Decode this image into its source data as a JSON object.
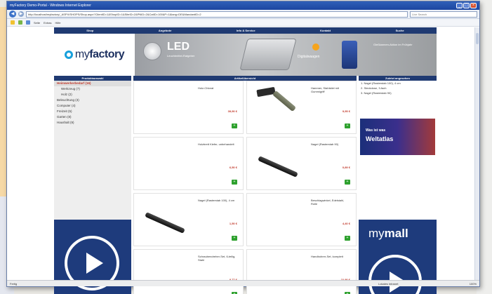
{
  "browser": {
    "title": "myFactory Demo-Portal - Windows Internet Explorer",
    "url": "http://localhost/myfactory/_ASPX/SHOPS/Shop.aspx?ClientID=1&ShopID=1&SiteID=2&PNID=2&CatID=100&P=1&lang=DE&MandantID=2",
    "search_placeholder": "Live Search",
    "toolbar_items": [
      "Seite",
      "Extras",
      "Hilfe"
    ],
    "status_text": "Fertig",
    "zone_text": "Lokales Intranet",
    "zoom_text": "100%"
  },
  "page": {
    "nav": [
      "Shop",
      "Angebote",
      "Info & Service",
      "Kontakt",
      "Suche"
    ],
    "logo": {
      "prefix": "my",
      "suffix": "factory"
    },
    "banner": {
      "led_title": "LED",
      "led_sub": "Leuchtmittel-Ratgeber",
      "scale_text": "Digitalwaagen",
      "right_text": "Gießkannen-Aktion\nim Frühjahr"
    },
    "column_headers": [
      "Produktauswahl",
      "Artikelübersicht",
      "Zuletzt angesehen"
    ],
    "categories": [
      {
        "label": "Heimwerkerbedarf (16)",
        "active": true,
        "sub": false
      },
      {
        "label": "Werkzeug (7)",
        "active": false,
        "sub": true
      },
      {
        "label": "Holz (2)",
        "active": false,
        "sub": true
      },
      {
        "label": "Beleuchtung (3)",
        "active": false,
        "sub": false
      },
      {
        "label": "Computer (4)",
        "active": false,
        "sub": false
      },
      {
        "label": "Freizeit (5)",
        "active": false,
        "sub": false
      },
      {
        "label": "Garten (8)",
        "active": false,
        "sub": false
      },
      {
        "label": "Haushalt (9)",
        "active": false,
        "sub": false
      }
    ],
    "products": [
      {
        "name": "Holz-Chlorat",
        "price": "39,90 €",
        "image": "none"
      },
      {
        "name": "Hammer, Stahlstiel mit Gummigriff",
        "price": "9,95 €",
        "image": "hammer"
      },
      {
        "name": "Holzbrett Kiefer, unbehandelt",
        "price": "6,50 €",
        "image": "none"
      },
      {
        "name": "Nagel (Rasterstab 90)",
        "price": "0,89 €",
        "image": "nail"
      },
      {
        "name": "Nagel (Rasterstab 100), 4 cm",
        "price": "1,50 €",
        "image": "nail"
      },
      {
        "name": "Beschlagwinkel, Edelstahl, Rolle",
        "price": "4,40 €",
        "image": "none"
      },
      {
        "name": "Schraubendreher-Set, 6-teilig, Stahl",
        "price": "8,77 €",
        "image": "none"
      },
      {
        "name": "Handbohrer-Set, komplett",
        "price": "22,90 €",
        "image": "none"
      }
    ],
    "cart_symbol": "+",
    "recent": [
      "1. Nagel (Rasterstab 100), 4 cm",
      "2. Steckdose, 3-fach",
      "3. Nagel (Rasterstab 90)"
    ],
    "atlas": {
      "line1": "Was ist was",
      "line2": "Weltatlas"
    },
    "mymall": {
      "prefix": "my",
      "suffix": "mall"
    }
  },
  "colors": {
    "nav_bg": "#1f3a72",
    "promo_bg": "#1e3b7c",
    "price": "#c0392b",
    "cart": "#2ea12e",
    "logo_accent": "#17a0dc"
  }
}
